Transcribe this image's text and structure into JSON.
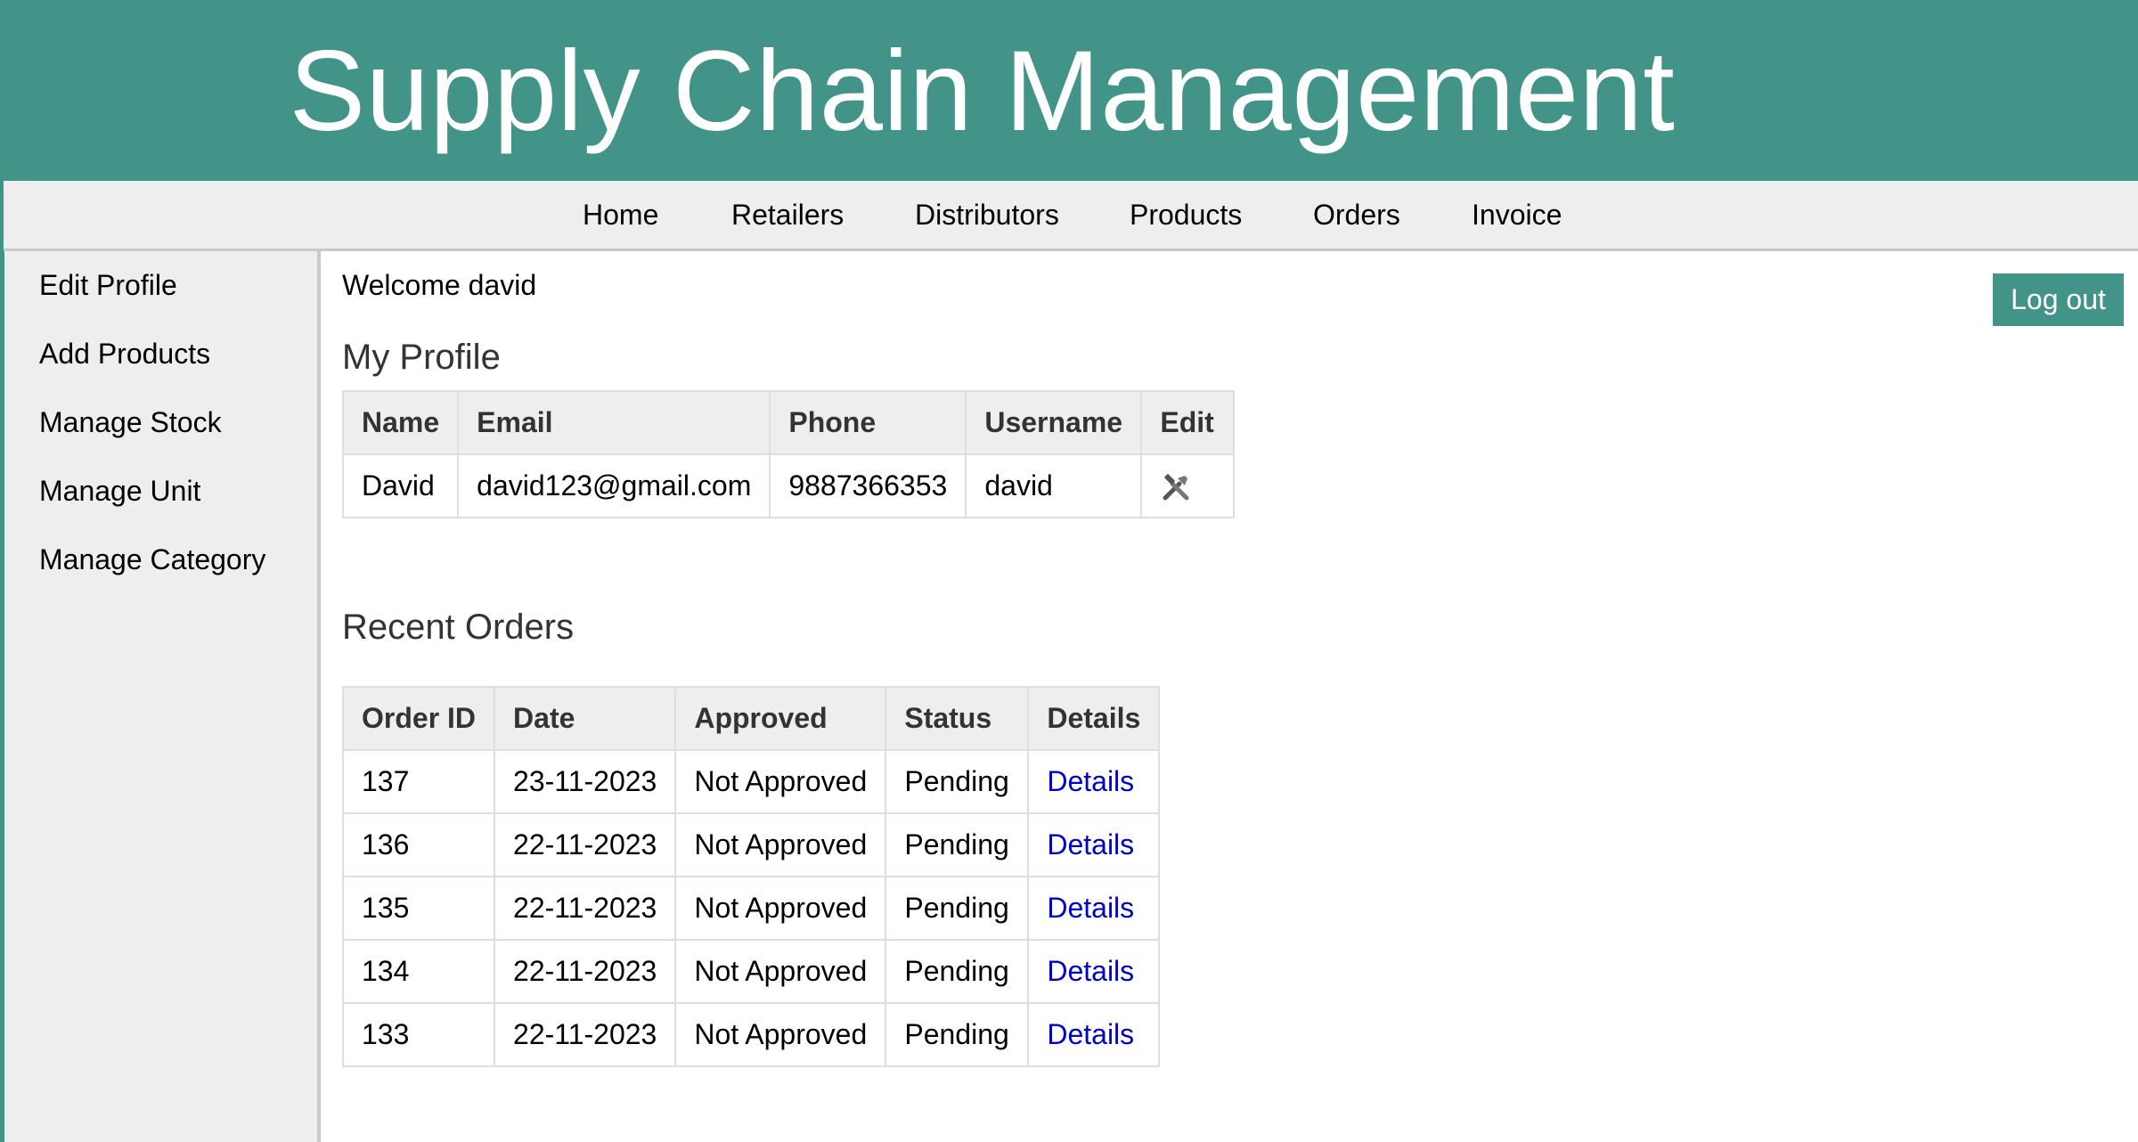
{
  "header": {
    "title": "Supply Chain Management"
  },
  "topnav": {
    "items": [
      "Home",
      "Retailers",
      "Distributors",
      "Products",
      "Orders",
      "Invoice"
    ]
  },
  "sidebar": {
    "items": [
      "Edit Profile",
      "Add Products",
      "Manage Stock",
      "Manage Unit",
      "Manage Category"
    ]
  },
  "main": {
    "welcome": "Welcome david",
    "logout_label": "Log out",
    "profile": {
      "title": "My Profile",
      "headers": [
        "Name",
        "Email",
        "Phone",
        "Username",
        "Edit"
      ],
      "row": {
        "name": "David",
        "email": "david123@gmail.com",
        "phone": "9887366353",
        "username": "david",
        "edit_icon": "tools-icon"
      }
    },
    "orders": {
      "title": "Recent Orders",
      "headers": [
        "Order ID",
        "Date",
        "Approved",
        "Status",
        "Details"
      ],
      "rows": [
        [
          "137",
          "23-11-2023",
          "Not Approved",
          "Pending",
          "Details"
        ],
        [
          "136",
          "22-11-2023",
          "Not Approved",
          "Pending",
          "Details"
        ],
        [
          "135",
          "22-11-2023",
          "Not Approved",
          "Pending",
          "Details"
        ],
        [
          "134",
          "22-11-2023",
          "Not Approved",
          "Pending",
          "Details"
        ],
        [
          "133",
          "22-11-2023",
          "Not Approved",
          "Pending",
          "Details"
        ]
      ]
    }
  },
  "colors": {
    "brand": "#429488",
    "panel": "#eeeeee",
    "link": "#0000cc"
  }
}
